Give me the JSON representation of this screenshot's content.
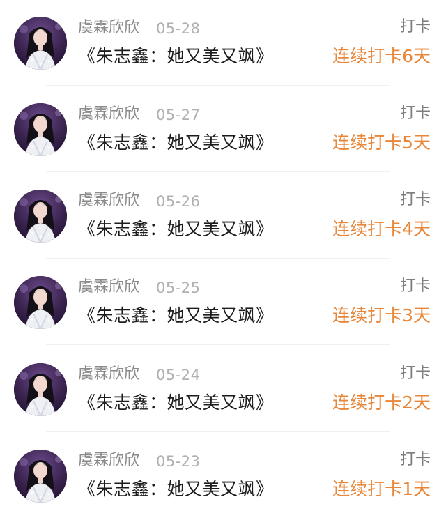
{
  "colors": {
    "streak_text": "#e8873a",
    "username_text": "#8a8a8a",
    "date_text": "#b0b0b0",
    "title_text": "#1c1c1c",
    "action_text": "#7e7e7e"
  },
  "items": [
    {
      "avatar": "user-avatar-icon",
      "username": "虞霖欣欣",
      "date": "05-28",
      "action": "打卡",
      "title": "《朱志鑫：她又美又飒》",
      "streak": "连续打卡6天"
    },
    {
      "avatar": "user-avatar-icon",
      "username": "虞霖欣欣",
      "date": "05-27",
      "action": "打卡",
      "title": "《朱志鑫：她又美又飒》",
      "streak": "连续打卡5天"
    },
    {
      "avatar": "user-avatar-icon",
      "username": "虞霖欣欣",
      "date": "05-26",
      "action": "打卡",
      "title": "《朱志鑫：她又美又飒》",
      "streak": "连续打卡4天"
    },
    {
      "avatar": "user-avatar-icon",
      "username": "虞霖欣欣",
      "date": "05-25",
      "action": "打卡",
      "title": "《朱志鑫：她又美又飒》",
      "streak": "连续打卡3天"
    },
    {
      "avatar": "user-avatar-icon",
      "username": "虞霖欣欣",
      "date": "05-24",
      "action": "打卡",
      "title": "《朱志鑫：她又美又飒》",
      "streak": "连续打卡2天"
    },
    {
      "avatar": "user-avatar-icon",
      "username": "虞霖欣欣",
      "date": "05-23",
      "action": "打卡",
      "title": "《朱志鑫：她又美又飒》",
      "streak": "连续打卡1天"
    }
  ]
}
